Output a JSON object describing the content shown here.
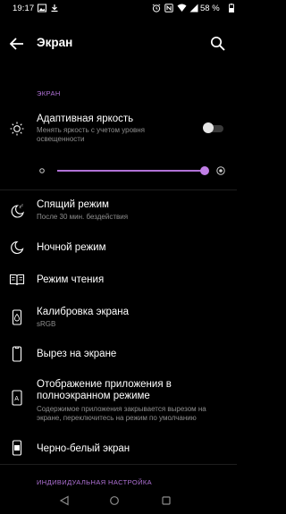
{
  "status_bar": {
    "time": "19:17",
    "battery": "58 %"
  },
  "toolbar": {
    "title": "Экран"
  },
  "sections": {
    "display": "ЭКРАН",
    "customization": "ИНДИВИДУАЛЬНАЯ НАСТРОЙКА"
  },
  "adaptive_brightness": {
    "title": "Адаптивная яркость",
    "subtitle_line1": "Менять яркость с учетом уровня",
    "subtitle_line2": "освещенности",
    "enabled": false
  },
  "brightness_slider": {
    "value_fraction": 0.97
  },
  "items": {
    "sleep": {
      "title": "Спящий режим",
      "subtitle": "После 30 мин. бездействия"
    },
    "night": {
      "title": "Ночной режим"
    },
    "reading": {
      "title": "Режим чтения"
    },
    "calibration": {
      "title": "Калибровка экрана",
      "subtitle": "sRGB"
    },
    "cutout": {
      "title": "Вырез на экране"
    },
    "fullscreen": {
      "title_line1": "Отображение приложения в",
      "title_line2": "полноэкранном режиме",
      "subtitle_line1": "Содержимое приложения закрывается вырезом на",
      "subtitle_line2": "экране, переключитесь на режим по умолчанию"
    },
    "monochrome": {
      "title": "Черно-белый экран"
    }
  },
  "colors": {
    "accent": "#b072d6",
    "background": "#000000",
    "secondary_text": "#8e8e8e"
  }
}
